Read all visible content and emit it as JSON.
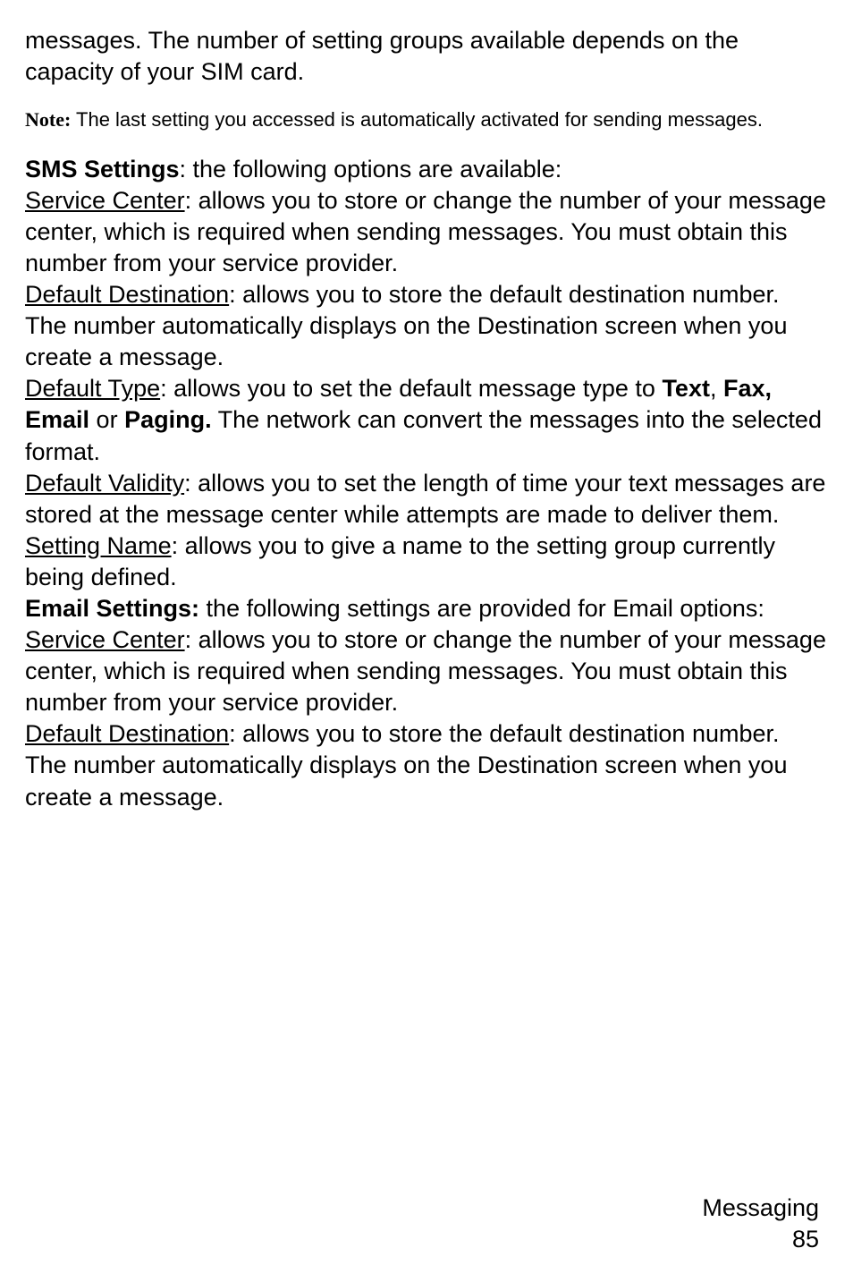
{
  "intro": "messages. The number of setting groups available depends on the capacity of your SIM card.",
  "note": {
    "label": "Note:",
    "text": " The last setting you accessed is automatically activated for sending messages."
  },
  "smsSettings": {
    "heading": "SMS Settings",
    "headingSuffix": ": the following options are available:",
    "serviceCenter": {
      "label": "Service Center",
      "text": ": allows you to store or change the number of your message center, which is required when sending messages. You must obtain this number from your service provider."
    },
    "defaultDestination": {
      "label": "Default Destination",
      "text": ": allows you to store the default destination number. The number automatically displays on the Destination screen when you create a message."
    },
    "defaultType": {
      "label": "Default Type",
      "text1": ": allows you to set the default message type to ",
      "boldText": "Text",
      "comma": ", ",
      "boldFax": "Fax, Email",
      "or": " or ",
      "boldPaging": "Paging.",
      "text2": " The network can convert the messages into the selected format."
    },
    "defaultValidity": {
      "label": "Default Validity",
      "text": ": allows you to set the length of time your text messages are stored at the message center while attempts are made to deliver them."
    },
    "settingName": {
      "label": "Setting Name",
      "text": ": allows you to give a name to the setting group currently being defined."
    }
  },
  "emailSettings": {
    "heading": "Email Settings:",
    "headingSuffix": " the following settings are provided for Email options:",
    "serviceCenter": {
      "label": "Service Center",
      "text": ": allows you to store or change the number of your message center, which is required when sending messages. You must obtain this number from your service provider."
    },
    "defaultDestination": {
      "label": "Default Destination",
      "text": ": allows you to store the default destination number. The number automatically displays on the Destination screen when you create a message."
    }
  },
  "footer": {
    "section": "Messaging",
    "page": "85"
  }
}
